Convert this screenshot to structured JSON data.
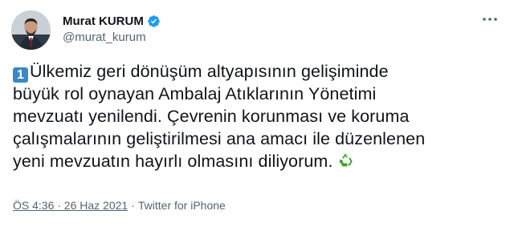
{
  "tweet": {
    "author": {
      "display_name": "Murat KURUM",
      "handle": "@murat_kurum",
      "verified": true,
      "avatar_icon": "avatar-person"
    },
    "lead_icon": "keycap-1",
    "lead_glyph": "1",
    "text": "Ülkemiz geri dönüşüm altyapısının gelişiminde\nbüyük rol oynayan Ambalaj Atıklarının Yönetimi\nmevzuatı yenilendi. Çevrenin korunması ve koruma\nçalışmalarının geliştirilmesi ana amacı ile düzenlenen\nyeni mevzuatın hayırlı olmasını diliyorum.",
    "trail_icon": "recycle-icon",
    "time": "ÖS 4:36 · 26 Haz 2021",
    "separator": "·",
    "source": "Twitter for iPhone"
  },
  "colors": {
    "text": "#0f1419",
    "muted": "#536471",
    "verified": "#1d9bf0",
    "keycap": "#3b88c3",
    "recycle": "#3aa12b"
  }
}
